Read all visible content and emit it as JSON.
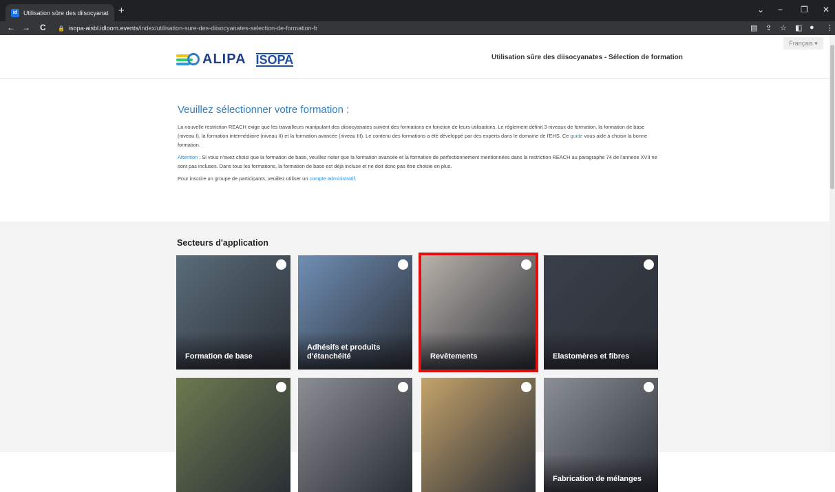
{
  "browser": {
    "tab_title": "Utilisation sûre des diisocyanates ×",
    "tab_favicon": "id",
    "new_tab": "+",
    "url_host": "isopa-aisbl.idloom.events",
    "url_path": "/index/utilisation-sure-des-diisocyanates-selection-de-formation-fr",
    "back_icon": "←",
    "forward_icon": "→",
    "reload_icon": "C",
    "minimize": "−",
    "restore": "❐",
    "close": "✕",
    "chevron": "⌄"
  },
  "header": {
    "brand_alipa": "ALIPA",
    "brand_isopa": "ISOPA",
    "title": "Utilisation sûre des diisocyanates - Sélection de formation",
    "language": "Français ▾"
  },
  "intro": {
    "heading": "Veuillez sélectionner votre formation :",
    "p1_before": "La nouvelle restriction REACH exige que les travailleurs manipulant des diisocyanates suivent des formations en fonction de leurs utilisations. Le règlement définit 3 niveaux de formation, la formation de base (niveau I), la formation intermédiaire (niveau II) et la formation avancée (niveau III). Le contenu des formations a été développé par des experts dans le domaine de l'EHS. Ce ",
    "p1_link": "guide",
    "p1_after": " vous aide à choisir la bonne formation.",
    "attention_label": "Attention",
    "p2_text": " : Si vous n'avez choisi que la formation de base, veuillez noter que la formation avancée et la formation de perfectionnement mentionnées dans la restriction REACH au paragraphe 74 de l'annexe XVII ne sont pas incluses. Dans tous les formations, la formation de base est déjà incluse et ne doit donc pas être choisie en plus.",
    "p3_before": "Pour inscrire un groupe de participants, veuillez utiliser un ",
    "p3_link": "compte administratif",
    "p3_after": "."
  },
  "sectors": {
    "heading": "Secteurs d'application",
    "cards": [
      {
        "label": "Formation de base",
        "color": "#5a6d7a"
      },
      {
        "label": "Adhésifs et produits d'étanchéité",
        "color": "#6f8fb5"
      },
      {
        "label": "Revêtements",
        "color": "#b9b2ab"
      },
      {
        "label": "Elastomères et fibres",
        "color": "#3b3f4a"
      },
      {
        "label": "",
        "color": "#6c7a4f"
      },
      {
        "label": "",
        "color": "#8b8e94"
      },
      {
        "label": "",
        "color": "#c4a36a"
      },
      {
        "label": "Fabrication de mélanges",
        "color": "#8c9096"
      }
    ]
  }
}
